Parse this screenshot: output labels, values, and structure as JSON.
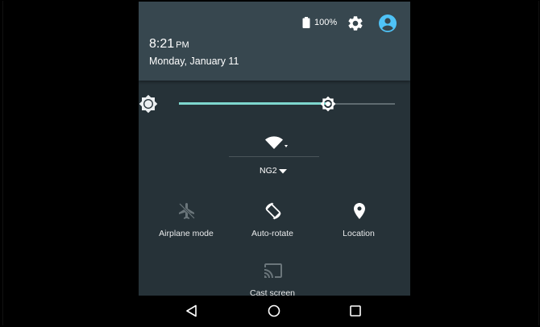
{
  "status_bar": {
    "battery_percent": "100%",
    "battery_icon": "battery-full-icon",
    "settings_icon": "gear-icon",
    "user_icon": "account-circle-icon"
  },
  "header": {
    "time": "8:21",
    "ampm": "PM",
    "date": "Monday, January 11"
  },
  "brightness": {
    "icon": "brightness-icon",
    "level_fraction": 0.69
  },
  "wifi": {
    "icon": "wifi-icon",
    "network_name": "NG2"
  },
  "tiles": [
    {
      "label": "Airplane mode",
      "icon": "airplane-icon"
    },
    {
      "label": "Auto-rotate",
      "icon": "auto-rotate-icon"
    },
    {
      "label": "Location",
      "icon": "location-pin-icon"
    },
    {
      "label": "Cast screen",
      "icon": "cast-icon"
    }
  ],
  "nav": {
    "back_icon": "back-triangle-icon",
    "home_icon": "home-circle-icon",
    "recents_icon": "recents-square-icon"
  },
  "colors": {
    "shade_background": "#263238",
    "header_background": "#37474f",
    "accent": "#7ed7ce",
    "user_icon_color": "#4fc3f7"
  }
}
